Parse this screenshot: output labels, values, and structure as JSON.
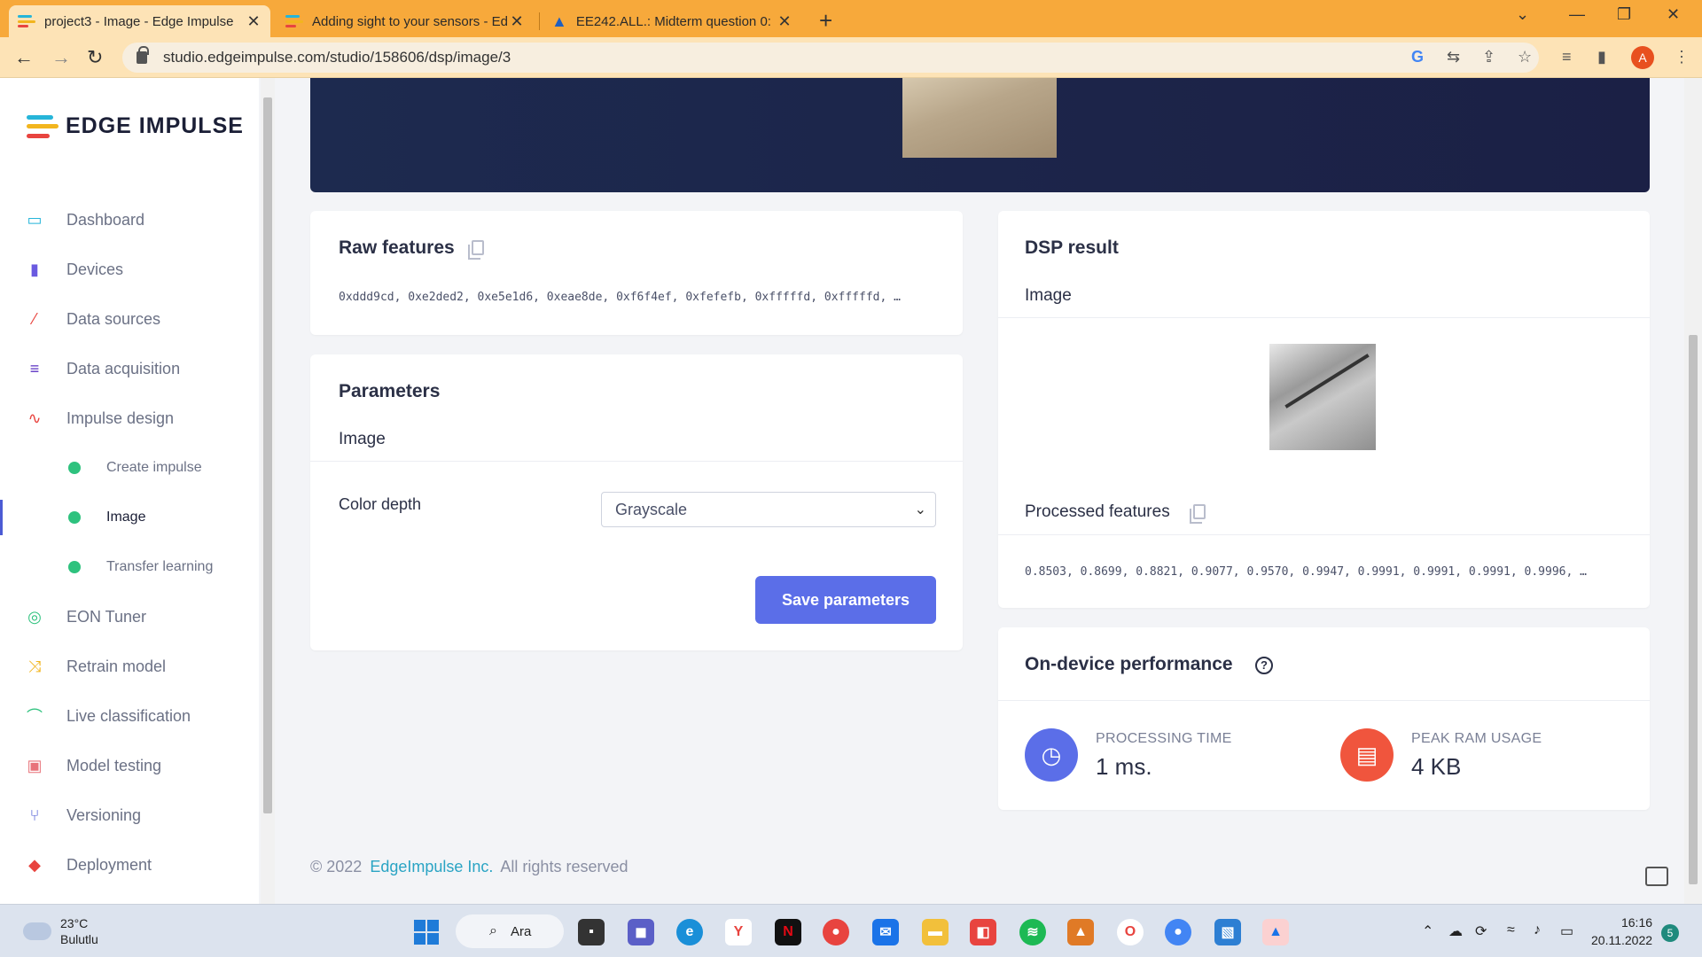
{
  "browser": {
    "tabs": [
      {
        "title": "project3 - Image - Edge Impulse",
        "active": true
      },
      {
        "title": "Adding sight to your sensors - Ed",
        "active": false
      },
      {
        "title": "EE242.ALL.: Midterm question 0:",
        "active": false
      }
    ],
    "url": "studio.edgeimpulse.com/studio/158606/dsp/image/3",
    "profile_initial": "A"
  },
  "sidebar": {
    "logo_text": "EDGE IMPULSE",
    "items": [
      {
        "label": "Dashboard",
        "icon": "monitor-icon",
        "color": "#26b5d9"
      },
      {
        "label": "Devices",
        "icon": "chip-icon",
        "color": "#6a5ae0"
      },
      {
        "label": "Data sources",
        "icon": "wand-icon",
        "color": "#e8443f"
      },
      {
        "label": "Data acquisition",
        "icon": "database-icon",
        "color": "#5a2fc2"
      },
      {
        "label": "Impulse design",
        "icon": "pulse-icon",
        "color": "#e8443f"
      }
    ],
    "subitems": [
      {
        "label": "Create impulse"
      },
      {
        "label": "Image"
      },
      {
        "label": "Transfer learning"
      }
    ],
    "items2": [
      {
        "label": "EON Tuner",
        "icon": "compass-icon",
        "color": "#2ec27e"
      },
      {
        "label": "Retrain model",
        "icon": "shuffle-icon",
        "color": "#f2b51e"
      },
      {
        "label": "Live classification",
        "icon": "signal-icon",
        "color": "#2ec27e"
      },
      {
        "label": "Model testing",
        "icon": "clipboard-icon",
        "color": "#e8737a"
      },
      {
        "label": "Versioning",
        "icon": "branch-icon",
        "color": "#4c5bd4"
      },
      {
        "label": "Deployment",
        "icon": "box-icon",
        "color": "#e8443f"
      }
    ]
  },
  "raw_features": {
    "title": "Raw features",
    "values": "0xddd9cd, 0xe2ded2, 0xe5e1d6, 0xeae8de, 0xf6f4ef, 0xfefefb, 0xfffffd, 0xfffffd, …"
  },
  "parameters": {
    "title": "Parameters",
    "section": "Image",
    "color_depth_label": "Color depth",
    "color_depth_value": "Grayscale",
    "save_label": "Save parameters"
  },
  "dsp_result": {
    "title": "DSP result",
    "image_label": "Image",
    "processed_label": "Processed features",
    "processed_values": "0.8503, 0.8699, 0.8821, 0.9077, 0.9570, 0.9947, 0.9991, 0.9991, 0.9991, 0.9996, …"
  },
  "performance": {
    "title": "On-device performance",
    "processing_label": "PROCESSING TIME",
    "processing_value": "1 ms.",
    "ram_label": "PEAK RAM USAGE",
    "ram_value": "4 KB"
  },
  "footer": {
    "copyright": "© 2022",
    "company": "EdgeImpulse Inc.",
    "rights": "All rights reserved"
  },
  "taskbar": {
    "temperature": "23°C",
    "weather": "Bulutlu",
    "search_label": "Ara",
    "time": "16:16",
    "date": "20.11.2022",
    "notifications": "5"
  },
  "colors": {
    "accent": "#5b6ee8",
    "browser_bar": "#f7a93b",
    "hero": "#1d2a4f"
  }
}
